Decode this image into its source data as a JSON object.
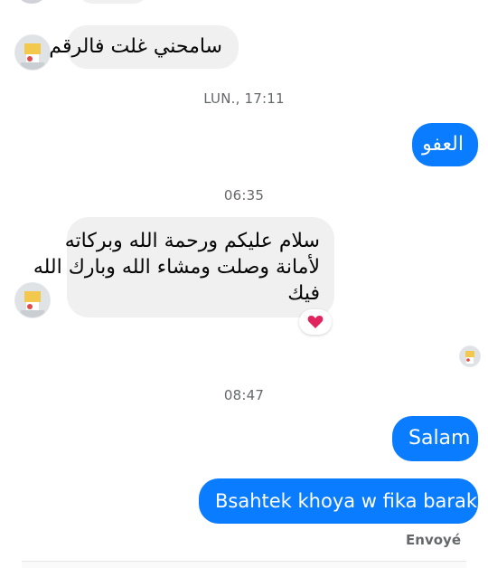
{
  "colors": {
    "outgoing_bubble": "#0a7cff",
    "incoming_bubble": "#f0f0f0",
    "reaction_heart": "#e0245e",
    "timestamp_text": "#65676b"
  },
  "messages": [
    {
      "direction": "incoming",
      "text": "سامحني غلت فالرقم"
    },
    {
      "direction": "outgoing",
      "text": "العفو"
    },
    {
      "direction": "incoming",
      "lines": [
        "سلام عليكم ورحمة الله وبركاته",
        "لأمانة وصلت ومشاء الله وبارك الله",
        "فيك"
      ],
      "reaction": "heart-icon"
    },
    {
      "direction": "outgoing",
      "text": "Salam"
    },
    {
      "direction": "outgoing",
      "text": "Bsahtek khoya w fika baraka"
    }
  ],
  "timestamps": [
    "LUN., 17:11",
    "06:35",
    "08:47"
  ],
  "status": "Envoyé",
  "avatar_icon": "contact-avatar-icon"
}
